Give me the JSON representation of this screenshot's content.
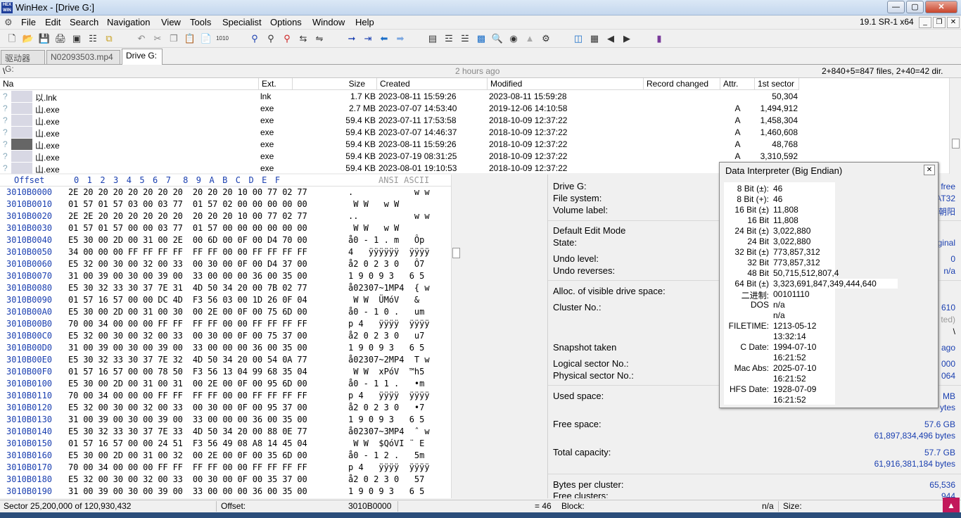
{
  "window": {
    "title": "WinHex - [Drive G:]",
    "version": "19.1 SR-1 x64"
  },
  "menu": [
    "File",
    "Edit",
    "Search",
    "Navigation",
    "View",
    "Tools",
    "Specialist",
    "Options",
    "Window",
    "Help"
  ],
  "tabs": [
    "驱动器 G:",
    "N02093503.mp4",
    "Drive G:"
  ],
  "path": {
    "dir": "\\",
    "time": "2 hours ago",
    "count": "2+840+5=847 files, 2+40=42 dir."
  },
  "filelist": {
    "headers": [
      "Na",
      "Ext.",
      "Size",
      "Created",
      "Modified",
      "Record changed",
      "Attr.",
      "1st sector"
    ],
    "rows": [
      [
        "以.lnk",
        "lnk",
        "1.7 KB",
        "2023-08-11  15:59:26",
        "2023-08-11  15:59:28",
        "",
        "",
        "50,304"
      ],
      [
        "山.exe",
        "exe",
        "2.7 MB",
        "2023-07-07  14:53:40",
        "2019-12-06  14:10:58",
        "",
        "A",
        "1,494,912"
      ],
      [
        "山.exe",
        "exe",
        "59.4 KB",
        "2023-07-11  17:53:58",
        "2018-10-09  12:37:22",
        "",
        "A",
        "1,458,304"
      ],
      [
        "山.exe",
        "exe",
        "59.4 KB",
        "2023-07-07  14:46:37",
        "2018-10-09  12:37:22",
        "",
        "A",
        "1,460,608"
      ],
      [
        "山.exe",
        "exe",
        "59.4 KB",
        "2023-08-11  15:59:26",
        "2018-10-09  12:37:22",
        "",
        "A",
        "48,768"
      ],
      [
        "山.exe",
        "exe",
        "59.4 KB",
        "2023-07-19  08:31:25",
        "2018-10-09  12:37:22",
        "",
        "A",
        "3,310,592"
      ],
      [
        "山.exe",
        "exe",
        "59.4 KB",
        "2023-08-01  19:10:53",
        "2018-10-09  12:37:22",
        "",
        "A",
        "3,311,104"
      ]
    ]
  },
  "hex": {
    "offset_label": "Offset",
    "columns": "0  1  2  3  4  5  6  7   8  9  A  B  C  D  E  F",
    "ascii_label": "ANSI ASCII",
    "rows": [
      [
        "3010B0000",
        "2E 20 20 20 20 20 20 20  20 20 20 10 00 77 02 77",
        ".            w w"
      ],
      [
        "3010B0010",
        "01 57 01 57 03 00 03 77  01 57 02 00 00 00 00 00",
        " W W   w W      "
      ],
      [
        "3010B0020",
        "2E 2E 20 20 20 20 20 20  20 20 20 10 00 77 02 77",
        "..           w w"
      ],
      [
        "3010B0030",
        "01 57 01 57 00 00 03 77  01 57 00 00 00 00 00 00",
        " W W   w W      "
      ],
      [
        "3010B0040",
        "E5 30 00 2D 00 31 00 2E  00 6D 00 0F 00 D4 70 00",
        "å0 - 1 . m   Ôp "
      ],
      [
        "3010B0050",
        "34 00 00 00 FF FF FF FF  FF FF 00 00 FF FF FF FF",
        "4   ÿÿÿÿÿÿ  ÿÿÿÿ"
      ],
      [
        "3010B0060",
        "E5 32 00 30 00 32 00 33  00 30 00 0F 00 D4 37 00",
        "å2 0 2 3 0   Ô7 "
      ],
      [
        "3010B0070",
        "31 00 39 00 30 00 39 00  33 00 00 00 36 00 35 00",
        "1 9 0 9 3   6 5 "
      ],
      [
        "3010B0080",
        "E5 30 32 33 30 37 7E 31  4D 50 34 20 00 7B 02 77",
        "å02307~1MP4  { w"
      ],
      [
        "3010B0090",
        "01 57 16 57 00 00 DC 4D  F3 56 03 00 1D 26 0F 04",
        " W W  ÜMóV   &  "
      ],
      [
        "3010B00A0",
        "E5 30 00 2D 00 31 00 30  00 2E 00 0F 00 75 6D 00",
        "å0 - 1 0 .   um "
      ],
      [
        "3010B00B0",
        "70 00 34 00 00 00 FF FF  FF FF 00 00 FF FF FF FF",
        "p 4   ÿÿÿÿ  ÿÿÿÿ"
      ],
      [
        "3010B00C0",
        "E5 32 00 30 00 32 00 33  00 30 00 0F 00 75 37 00",
        "å2 0 2 3 0   u7 "
      ],
      [
        "3010B00D0",
        "31 00 39 00 30 00 39 00  33 00 00 00 36 00 35 00",
        "1 9 0 9 3   6 5 "
      ],
      [
        "3010B00E0",
        "E5 30 32 33 30 37 7E 32  4D 50 34 20 00 54 0A 77",
        "å02307~2MP4  T w"
      ],
      [
        "3010B00F0",
        "01 57 16 57 00 00 78 50  F3 56 13 04 99 68 35 04",
        " W W  xPóV  ™h5 "
      ],
      [
        "3010B0100",
        "E5 30 00 2D 00 31 00 31  00 2E 00 0F 00 95 6D 00",
        "å0 - 1 1 .   •m "
      ],
      [
        "3010B0110",
        "70 00 34 00 00 00 FF FF  FF FF 00 00 FF FF FF FF",
        "p 4   ÿÿÿÿ  ÿÿÿÿ"
      ],
      [
        "3010B0120",
        "E5 32 00 30 00 32 00 33  00 30 00 0F 00 95 37 00",
        "å2 0 2 3 0   •7 "
      ],
      [
        "3010B0130",
        "31 00 39 00 30 00 39 00  33 00 00 00 36 00 35 00",
        "1 9 0 9 3   6 5 "
      ],
      [
        "3010B0140",
        "E5 30 32 33 30 37 7E 33  4D 50 34 20 00 88 0E 77",
        "å02307~3MP4  ˆ w"
      ],
      [
        "3010B0150",
        "01 57 16 57 00 00 24 51  F3 56 49 08 A8 14 45 04",
        " W W  $QóVI ¨ E "
      ],
      [
        "3010B0160",
        "E5 30 00 2D 00 31 00 32  00 2E 00 0F 00 35 6D 00",
        "å0 - 1 2 .   5m "
      ],
      [
        "3010B0170",
        "70 00 34 00 00 00 FF FF  FF FF 00 00 FF FF FF FF",
        "p 4   ÿÿÿÿ  ÿÿÿÿ"
      ],
      [
        "3010B0180",
        "E5 32 00 30 00 32 00 33  00 30 00 0F 00 35 37 00",
        "å2 0 2 3 0   57 "
      ],
      [
        "3010B0190",
        "31 00 39 00 30 00 39 00  33 00 00 00 36 00 35 00",
        "1 9 0 9 3   6 5 "
      ]
    ]
  },
  "info": {
    "drive": "Drive G:",
    "filesystem_label": "File system:",
    "filesystem": "FAT32",
    "volume_label": "Volume label:",
    "volume": "朝阳",
    "free_tag": "free",
    "edit_mode": "Default Edit Mode",
    "state_label": "State:",
    "state": "original",
    "undo_level_label": "Undo level:",
    "undo_level": "0",
    "undo_rev_label": "Undo reverses:",
    "undo_rev": "n/a",
    "alloc_label": "Alloc. of visible drive space:",
    "cluster_label": "Cluster No.:",
    "cluster": "610",
    "cluster_sub": "ted)",
    "cluster_path": "\\",
    "snapshot_label": "Snapshot taken",
    "snapshot": "ago",
    "logical_label": "Logical sector No.:",
    "logical": "000",
    "physical_label": "Physical sector No.:",
    "physical": "064",
    "used_label": "Used space:",
    "used": "MB",
    "used_bytes": "ytes",
    "free_label": "Free space:",
    "free": "57.6 GB",
    "free_bytes": "61,897,834,496 bytes",
    "total_label": "Total capacity:",
    "total": "57.7 GB",
    "total_bytes": "61,916,381,184 bytes",
    "bpc_label": "Bytes per cluster:",
    "bpc": "65,536",
    "fc_label": "Free clusters:",
    "fc": "944"
  },
  "interpreter": {
    "title": "Data Interpreter (Big Endian)",
    "rows": [
      [
        "8 Bit (±):",
        "46"
      ],
      [
        "8 Bit (+):",
        "46"
      ],
      [
        "16 Bit (±)",
        "11,808"
      ],
      [
        "16 Bit",
        "11,808"
      ],
      [
        "24 Bit (±)",
        "3,022,880"
      ],
      [
        "24 Bit",
        "3,022,880"
      ],
      [
        "32 Bit (±)",
        "773,857,312"
      ],
      [
        "32 Bit",
        "773,857,312"
      ],
      [
        "48 Bit",
        "50,715,512,807,4"
      ],
      [
        "64 Bit (±)",
        "3,323,691,847,349,444,640"
      ],
      [
        "二进制:",
        "00101110"
      ],
      [
        "DOS",
        "n/a"
      ],
      [
        "",
        "n/a"
      ],
      [
        "FILETIME:",
        "1213-05-12"
      ],
      [
        "",
        "13:32:14"
      ],
      [
        "C Date:",
        "1994-07-10"
      ],
      [
        "",
        "16:21:52"
      ],
      [
        "Mac Abs:",
        "2025-07-10"
      ],
      [
        "",
        "16:21:52"
      ],
      [
        "HFS Date:",
        "1928-07-09"
      ],
      [
        "",
        "16:21:52"
      ]
    ]
  },
  "status": {
    "sector": "Sector 25,200,000 of 120,930,432",
    "offset_label": "Offset:",
    "offset": "3010B0000",
    "value": "= 46",
    "block_label": "Block:",
    "block": "n/a",
    "size_label": "Size:"
  }
}
